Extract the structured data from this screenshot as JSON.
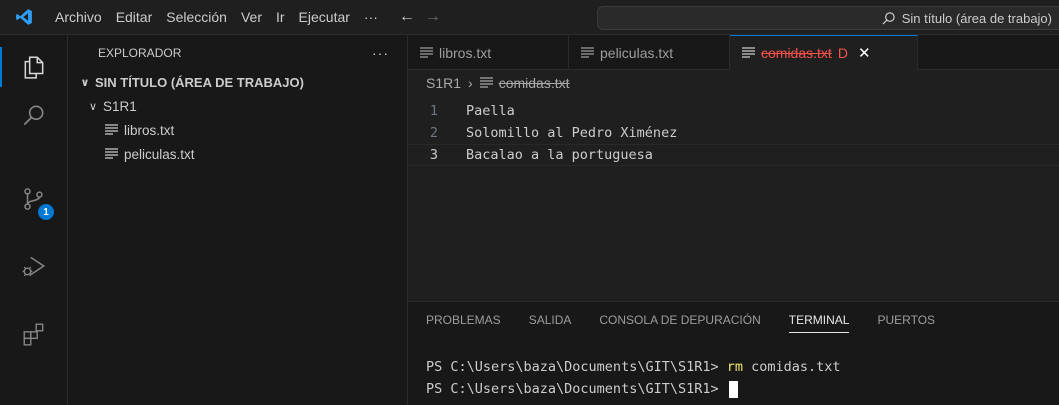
{
  "titlebar": {
    "menu": [
      "Archivo",
      "Editar",
      "Selección",
      "Ver",
      "Ir",
      "Ejecutar",
      "···"
    ],
    "search_text": "Sin título (área de trabajo)"
  },
  "activitybar": {
    "items": [
      "explorer-icon",
      "search-icon",
      "source-control-icon",
      "run-debug-icon",
      "extensions-icon"
    ],
    "source_control_badge": "1"
  },
  "sidebar": {
    "title": "EXPLORADOR",
    "more": "···",
    "workspace": "SIN TÍTULO (ÁREA DE TRABAJO)",
    "folder": "S1R1",
    "files": [
      "libros.txt",
      "peliculas.txt"
    ]
  },
  "tabs": [
    {
      "label": "libros.txt",
      "active": false
    },
    {
      "label": "peliculas.txt",
      "active": false
    },
    {
      "label": "comidas.txt",
      "active": true,
      "status": "D"
    }
  ],
  "breadcrumb": {
    "folder": "S1R1",
    "file": "comidas.txt"
  },
  "editor": {
    "lines": [
      {
        "num": "1",
        "text": "Paella"
      },
      {
        "num": "2",
        "text": "Solomillo al Pedro Ximénez"
      },
      {
        "num": "3",
        "text": "Bacalao a la portuguesa"
      }
    ]
  },
  "panel": {
    "tabs": [
      "PROBLEMAS",
      "SALIDA",
      "CONSOLA DE DEPURACIÓN",
      "TERMINAL",
      "PUERTOS"
    ],
    "active_tab": "TERMINAL",
    "terminal": {
      "prompt": "PS C:\\Users\\baza\\Documents\\GIT\\S1R1> ",
      "command": "rm",
      "args": " comidas.txt"
    }
  },
  "colors": {
    "accent": "#0078d4",
    "deleted": "#f85149",
    "command": "#f0e46a"
  }
}
